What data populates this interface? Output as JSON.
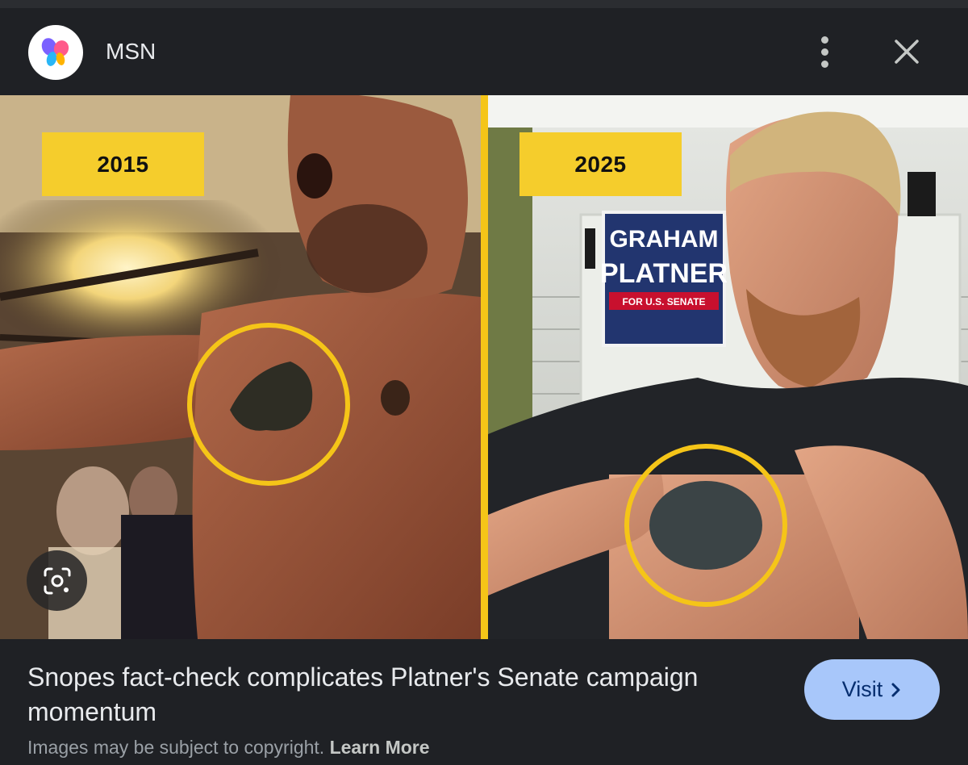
{
  "header": {
    "source_name": "MSN",
    "logo_icon": "msn-butterfly-icon",
    "menu_icon": "more-vert-icon",
    "close_icon": "close-icon"
  },
  "image": {
    "left_badge": "2015",
    "right_badge": "2025",
    "sign": {
      "line1": "GRAHAM",
      "line2": "PLATNER",
      "line3": "FOR U.S. SENATE"
    },
    "lens_icon": "google-lens-icon",
    "accent_color": "#f5c518"
  },
  "footer": {
    "headline": "Snopes fact-check complicates Platner's Senate campaign momentum",
    "visit_label": "Visit",
    "visit_icon": "chevron-right-icon",
    "copyright_text": "Images may be subject to copyright.",
    "learn_more": "Learn More"
  }
}
